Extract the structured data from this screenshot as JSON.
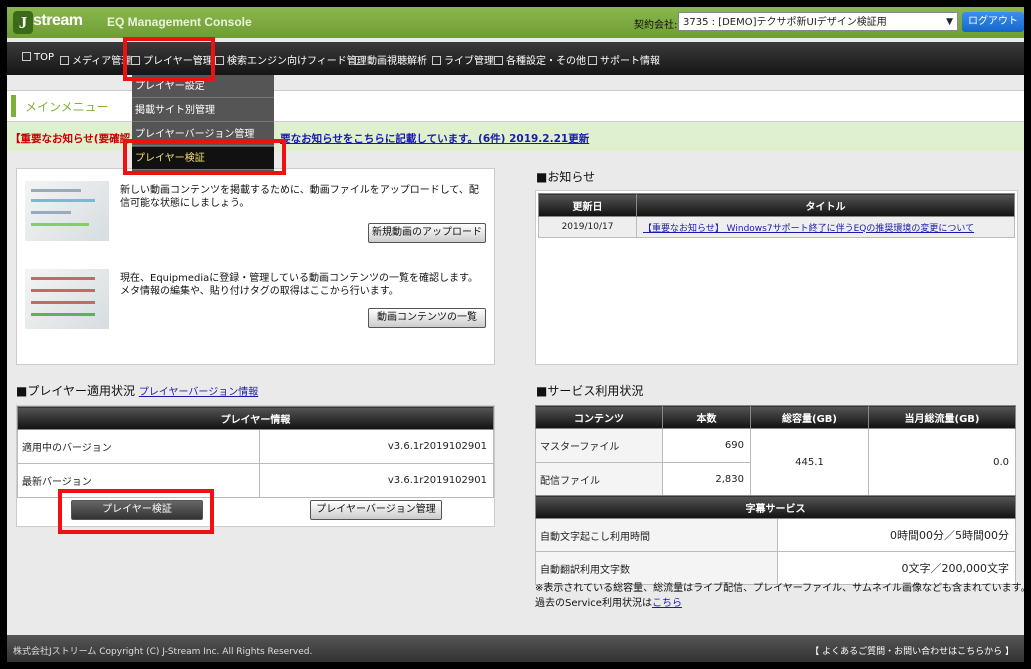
{
  "header": {
    "logo_text": "stream",
    "logo_letter": "J",
    "app_title": "EQ Management Console",
    "contract_label": "契約会社:",
    "contract_value": "3735 : [DEMO]テクサポ新UIデザイン検証用",
    "logout_label": "ログアウト"
  },
  "nav": {
    "items": [
      {
        "label": "TOP"
      },
      {
        "label": "メディア管理"
      },
      {
        "label": "プレイヤー管理"
      },
      {
        "label": "検索エンジン向けフィード管理"
      },
      {
        "label": "動画視聴解析"
      },
      {
        "label": "ライブ管理"
      },
      {
        "label": "各種設定・その他"
      },
      {
        "label": "サポート情報"
      }
    ]
  },
  "dropdown": {
    "items": [
      {
        "label": "プレイヤー設定"
      },
      {
        "label": "掲載サイト別管理"
      },
      {
        "label": "プレイヤーバージョン管理"
      },
      {
        "label": "プレイヤー検証"
      }
    ]
  },
  "main_menu_title": "メインメニュー",
  "notice": {
    "prefix": "【重要なお知らせ(要確認",
    "link": "要なお知らせをこちらに記載しています。(6件) 2019.2.21更新"
  },
  "quick": {
    "upload_text": "新しい動画コンテンツを掲載するために、動画ファイルをアップロードして、配信可能な状態にしましょう。",
    "upload_button": "新規動画のアップロード",
    "list_text": "現在、Equipmediaに登録・管理している動画コンテンツの一覧を確認します。メタ情報の編集や、貼り付けタグの取得はここから行います。",
    "list_button": "動画コンテンツの一覧"
  },
  "news": {
    "title": "■お知らせ",
    "col_date": "更新日",
    "col_title": "タイトル",
    "rows": [
      {
        "date": "2019/10/17",
        "title": "【重要なお知らせ】 Windows7サポート終了に伴うEQの推奨環境の変更について"
      }
    ]
  },
  "player_status": {
    "title": "■プレイヤー適用状況",
    "link": "プレイヤーバージョン情報",
    "table_header": "プレイヤー情報",
    "rows": [
      {
        "label": "適用中のバージョン",
        "value": "v3.6.1r2019102901"
      },
      {
        "label": "最新バージョン",
        "value": "v3.6.1r2019102901"
      }
    ],
    "verify_button": "プレイヤー検証",
    "version_button": "プレイヤーバージョン管理"
  },
  "service": {
    "title": "■サービス利用状況",
    "headers": [
      "コンテンツ",
      "本数",
      "総容量(GB)",
      "当月総流量(GB)"
    ],
    "rows": [
      {
        "label": "マスターファイル",
        "count": "690"
      },
      {
        "label": "配信ファイル",
        "count": "2,830"
      }
    ],
    "total_capacity": "445.1",
    "monthly_traffic": "0.0",
    "subtitle_header": "字幕サービス",
    "subtitle_rows": [
      {
        "label": "自動文字起こし利用時間",
        "value": "0時間00分／5時間00分"
      },
      {
        "label": "自動翻訳利用文字数",
        "value": "0文字／200,000文字"
      }
    ],
    "note": "※表示されている総容量、総流量はライブ配信、プレイヤーファイル、サムネイル画像なども含まれています。",
    "past_prefix": "過去のService利用状況は",
    "past_link": "こちら"
  },
  "footer": {
    "copyright": "株式会社Jストリーム  Copyright (C) J-Stream Inc. All Rights Reserved.",
    "faq": "【 よくあるご質問・お問い合わせはこちらから 】"
  }
}
